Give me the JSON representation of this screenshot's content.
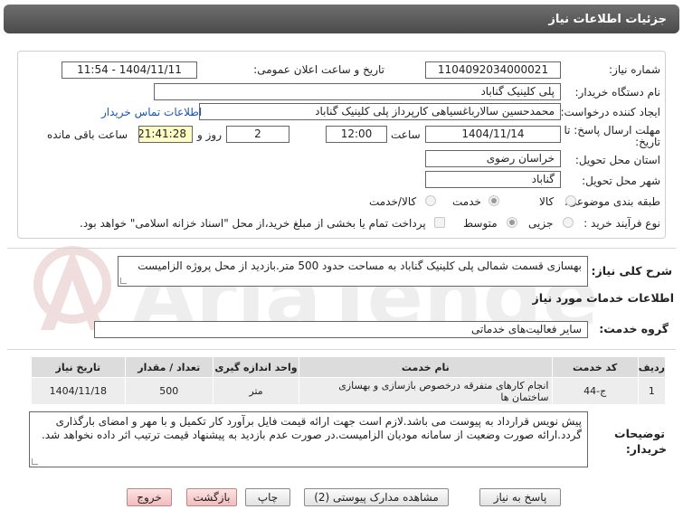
{
  "header": {
    "title": "جزئیات اطلاعات نیاز"
  },
  "fields": {
    "need_number_label": "شماره نیاز:",
    "need_number": "1104092034000021",
    "announce_label": "تاریخ و ساعت اعلان عمومی:",
    "announce_value": "1404/11/11 - 11:54",
    "buyer_org_label": "نام دستگاه خریدار:",
    "buyer_org": "پلی کلینیک گناباد",
    "creator_label": "ایجاد کننده درخواست:",
    "creator": "محمدحسین سالارباغسیاهی کارپرداز پلی کلینیک گناباد",
    "contact_link": "اطلاعات تماس خریدار",
    "deadline_label_1": "مهلت ارسال پاسخ: تا",
    "deadline_label_2": "تاریخ:",
    "deadline_date": "1404/11/14",
    "time_label": "ساعت",
    "deadline_time": "12:00",
    "days_value": "2",
    "days_label": "روز و",
    "remaining_time": "21:41:28",
    "remaining_label": "ساعت باقی مانده",
    "province_label": "استان محل تحویل:",
    "province": "خراسان رضوی",
    "city_label": "شهر محل تحویل:",
    "city": "گناباد",
    "category_label": "طبقه بندی موضوعی:",
    "category_options": [
      "کالا",
      "خدمت",
      "کالا/خدمت"
    ],
    "category_selected": "خدمت",
    "process_label": "نوع فرآیند خرید :",
    "process_options": [
      "جزیی",
      "متوسط"
    ],
    "process_selected": "متوسط",
    "payment_note": "پرداخت تمام یا بخشی از مبلغ خرید،از محل \"اسناد خزانه اسلامی\" خواهد بود."
  },
  "description": {
    "label": "شرح کلی نیاز:",
    "text": "بهسازی قسمت شمالی پلی کلینیک گناباد به مساحت حدود 500 متر.بازدید از محل پروژه الزامیست"
  },
  "services_section": {
    "title": "اطلاعات خدمات مورد نیاز",
    "group_label": "گروه خدمت:",
    "group_value": "سایر فعالیت‌های خدماتی"
  },
  "table": {
    "headers": [
      "ردیف",
      "کد خدمت",
      "نام خدمت",
      "واحد اندازه گیری",
      "تعداد / مقدار",
      "تاریخ نیاز"
    ],
    "rows": [
      [
        "1",
        "ج-44",
        "انجام کارهای متفرقه درخصوص بازسازی و بهسازی ساختمان ها",
        "متر",
        "500",
        "1404/11/18"
      ]
    ]
  },
  "notes": {
    "label_1": "توضیحات",
    "label_2": "خریدار:",
    "text": "پیش نویس قرارداد به پیوست می باشد.لازم است جهت ارائه قیمت فایل برآورد کار تکمیل و با مهر و امضای بارگذاری گردد.ارائه صورت وضعیت از سامانه مودیان الزامیست.در صورت عدم بازدید به پیشنهاد قیمت ترتیب اثر داده نخواهد شد."
  },
  "buttons": {
    "reply": "پاسخ به نیاز",
    "attachments": "مشاهده مدارک پیوستی (2)",
    "print": "چاپ",
    "back": "بازگشت",
    "exit": "خروج"
  },
  "watermark": {
    "text": "AriaTender.neT"
  },
  "colors": {
    "header_bg": "#5a5a5a",
    "link": "#1a57b0",
    "timer_bg": "#fffbc4",
    "exit_bg": "#f2bcbc"
  }
}
